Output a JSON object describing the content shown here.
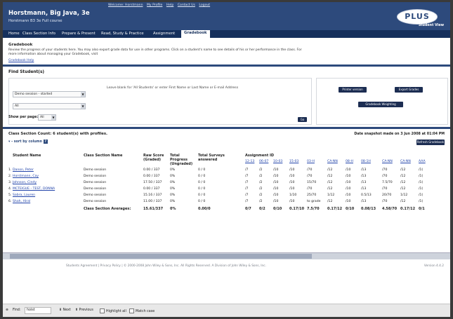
{
  "header": {
    "top_links": [
      "Welcome: Horstmann",
      "My Profile",
      "Help",
      "Contact Us",
      "Logout"
    ],
    "course_name": "Horstmann, Big Java, 3e",
    "course_sub": "Horstmann B3 3e Full course",
    "brand": "PLUS",
    "student_view": "Student View"
  },
  "nav": {
    "tabs": [
      "Home",
      "Class Section Info",
      "Prepare & Present",
      "Read, Study & Practice",
      "Assignment",
      "Gradebook"
    ],
    "active": "Gradebook"
  },
  "gradebook": {
    "title": "Gradebook",
    "intro": "Review the progress of your students here. You may also export grade data for use in other programs. Click on a student's name to see details of his or her performance in the class. For more information about managing your Gradebook, visit",
    "help_link": "Gradebook Help"
  },
  "find": {
    "title": "Find Student(s)",
    "hint": "Leave blank for 'All Students' or enter First Name or Last Name or E-mail Address",
    "section_select": "Demo session - started",
    "filter_select": "All",
    "per_page_label": "Show per page:",
    "per_page_value": "All",
    "go": "Go"
  },
  "actions": {
    "printer": "Printer version",
    "export": "Export Grades",
    "weighting": "Gradebook Weighting",
    "refresh": "Refresh Gradebook"
  },
  "class_section": {
    "count_label": "Class Section Count: 6 student(s) with profiles.",
    "sort_label": "sort by column",
    "snapshot": "Date snapshot made on 3 Jun 2008 at 01:04 PM"
  },
  "table": {
    "headers": [
      "Student Name",
      "Class Section Name",
      "Raw Score (Graded)",
      "Total Progress (Ungraded)",
      "Total Surveys answered",
      "Assignment ID"
    ],
    "assignment_ids": [
      "12-13",
      "06-07",
      "10-03",
      "15-03",
      "03-H",
      "CA-NN",
      "08-H",
      "08-1H",
      "CA-NN",
      "CA-NN",
      "AAA"
    ],
    "rows": [
      {
        "name": "Danon, Peter",
        "section": "Demo session",
        "raw": "0.00 / 337",
        "progress": "0%",
        "surveys": "0 / 0",
        "scores": [
          "/7",
          "/2",
          "/10",
          "/10",
          "/70",
          "/12",
          "/10",
          "/13",
          "/70",
          "/12",
          "/1("
        ]
      },
      {
        "name": "Horstmann, Cay",
        "section": "Demo session",
        "raw": "0.00 / 337",
        "progress": "0%",
        "surveys": "0 / 0",
        "scores": [
          "/7",
          "/2",
          "/10",
          "/10",
          "/70",
          "/12",
          "/10",
          "/13",
          "/70",
          "/12",
          "/1("
        ]
      },
      {
        "name": "Johnson, Cindy",
        "section": "Demo session",
        "raw": "17.50 / 337",
        "progress": "0%",
        "surveys": "0 / 0",
        "scores": [
          "/7",
          "/2",
          "/10",
          "/10",
          "15/70",
          "/12",
          "/10",
          "/13",
          "7.5/70",
          "/12",
          "/1("
        ]
      },
      {
        "name": "MCTEIGUE - TEST, DONNA",
        "section": "Demo session",
        "raw": "0.00 / 337",
        "progress": "0%",
        "surveys": "0 / 0",
        "scores": [
          "/7",
          "/2",
          "/10",
          "/10",
          "/70",
          "/12",
          "/10",
          "/13",
          "/70",
          "/12",
          "/1("
        ]
      },
      {
        "name": "Sabra, Lauren",
        "section": "Demo session",
        "raw": "15.16 / 337",
        "progress": "0%",
        "surveys": "0 / 0",
        "scores": [
          "/7",
          "/2",
          "/10",
          "1/10",
          "25/70",
          "1/12",
          "/10",
          "0.5/13",
          "20/70",
          "1/12",
          "/1("
        ]
      },
      {
        "name": "Shah, Hiral",
        "section": "Demo session",
        "raw": "11.00 / 337",
        "progress": "0%",
        "surveys": "0 / 0",
        "scores": [
          "/7",
          "/2",
          "/10",
          "/10",
          "to grade",
          "/12",
          "/10",
          "/13",
          "/70",
          "/12",
          "/1("
        ]
      }
    ],
    "averages_label": "Class Section Averages:",
    "averages": {
      "raw": "15.61/337",
      "progress": "0%",
      "surveys": "0.00/0",
      "scores": [
        "0/7",
        "0/2",
        "0/10",
        "0.17/10",
        "7.5/70",
        "0.17/12",
        "0/10",
        "0.08/13",
        "4.58/70",
        "0.17/12",
        "0/1"
      ]
    }
  },
  "footer": {
    "text": "Students Agreement  |  Privacy Policy  |  © 2000-2008 John Wiley & Sons, Inc. All Rights Reserved. A Division of John Wiley & Sons, Inc.",
    "version": "Version 4.4.2"
  },
  "findbar": {
    "label": "Find:",
    "value": "hoist",
    "next": "Next",
    "previous": "Previous",
    "highlight": "Highlight all",
    "match_case": "Match case"
  }
}
